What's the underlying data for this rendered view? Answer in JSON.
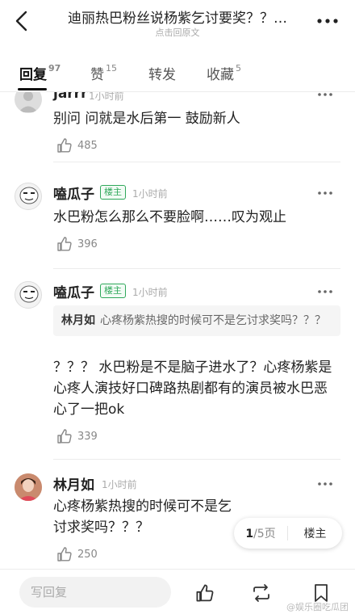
{
  "header": {
    "title": "迪丽热巴粉丝说杨紫乞讨要奖？？…",
    "subtitle": "点击回原文"
  },
  "tabs": [
    {
      "label": "回复",
      "count": "97",
      "active": true
    },
    {
      "label": "赞",
      "count": "15",
      "active": false
    },
    {
      "label": "转发",
      "count": "",
      "active": false
    },
    {
      "label": "收藏",
      "count": "5",
      "active": false
    }
  ],
  "comments": [
    {
      "name": "jarrr",
      "time": "1小时前",
      "text": "别问 问就是水后第一 鼓励新人",
      "likes": "485"
    },
    {
      "name": "嗑瓜子",
      "badge": "楼主",
      "time": "1小时前",
      "text": "水巴粉怎么那么不要脸啊……叹为观止",
      "likes": "396",
      "avatar_caption": "不忍直视"
    },
    {
      "name": "嗑瓜子",
      "badge": "楼主",
      "time": "1小时前",
      "quote_name": "林月如",
      "quote_text": "心疼杨紫热搜的时候可不是乞讨求奖吗？？？",
      "text": "？？？ 水巴粉是不是脑子进水了？心疼杨紫是心疼人演技好口碑路热剧都有的演员被水巴恶心了一把ok",
      "likes": "339",
      "avatar_caption": "不忍直视"
    },
    {
      "name": "林月如",
      "time": "1小时前",
      "text": "心疼杨紫热搜的时候可不是乞讨求奖吗？？？",
      "likes": "250"
    }
  ],
  "pager": {
    "current": "1",
    "total": "/5页",
    "op_label": "楼主"
  },
  "bottombar": {
    "reply_placeholder": "写回复",
    "watermark": "@娱乐圈吃瓜团"
  },
  "colors": {
    "accent_green": "#2fa85b",
    "text_main": "#222222",
    "text_muted": "#aaaaaa"
  }
}
